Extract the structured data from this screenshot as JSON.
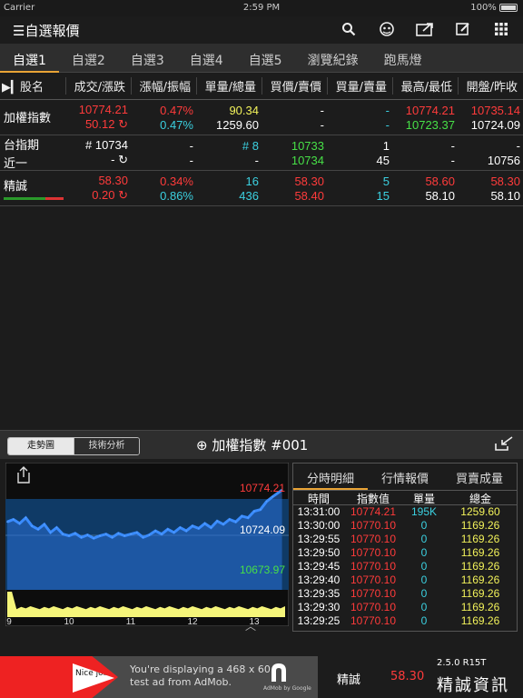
{
  "status_bar": {
    "carrier": "Carrier",
    "time": "2:59 PM",
    "battery": "100%"
  },
  "nav": {
    "title": "自選報價",
    "icons": [
      "search-icon",
      "alert-icon",
      "share-icon",
      "edit-icon",
      "grid-icon"
    ]
  },
  "tabs": [
    "自選1",
    "自選2",
    "自選3",
    "自選4",
    "自選5",
    "瀏覽紀錄",
    "跑馬燈"
  ],
  "active_tab": 0,
  "table_headers": [
    "股名",
    "成交/漲跌",
    "漲幅/振幅",
    "單量/總量",
    "買價/賣價",
    "買量/賣量",
    "最高/最低",
    "開盤/昨收"
  ],
  "rows": [
    {
      "name": "加權指數",
      "name2": "",
      "c": [
        [
          "10774.21",
          "red"
        ],
        [
          "50.12 ↻",
          "red"
        ],
        [
          "0.47%",
          "red"
        ],
        [
          "0.47%",
          "cyan"
        ],
        [
          "90.34",
          "yellow"
        ],
        [
          "1259.60",
          "white"
        ],
        [
          "-",
          "white"
        ],
        [
          "-",
          "white"
        ],
        [
          "-",
          "cyan"
        ],
        [
          "-",
          "cyan"
        ],
        [
          "10774.21",
          "red"
        ],
        [
          "10723.37",
          "green"
        ],
        [
          "10735.14",
          "red"
        ],
        [
          "10724.09",
          "white"
        ]
      ]
    },
    {
      "name": "台指期",
      "name2": "近一",
      "c": [
        [
          "# 10734",
          "white"
        ],
        [
          "- ↻",
          "white"
        ],
        [
          "-",
          "white"
        ],
        [
          "-",
          "white"
        ],
        [
          "# 8",
          "cyan"
        ],
        [
          "-",
          "white"
        ],
        [
          "10733",
          "green"
        ],
        [
          "10734",
          "green"
        ],
        [
          "1",
          "white"
        ],
        [
          "45",
          "white"
        ],
        [
          "-",
          "white"
        ],
        [
          "-",
          "white"
        ],
        [
          "-",
          "white"
        ],
        [
          "10756",
          "white"
        ]
      ]
    },
    {
      "name": "精誠",
      "name2": "",
      "c": [
        [
          "58.30",
          "red"
        ],
        [
          "0.20 ↻",
          "red"
        ],
        [
          "0.34%",
          "red"
        ],
        [
          "0.86%",
          "cyan"
        ],
        [
          "16",
          "cyan"
        ],
        [
          "436",
          "cyan"
        ],
        [
          "58.30",
          "red"
        ],
        [
          "58.40",
          "red"
        ],
        [
          "5",
          "cyan"
        ],
        [
          "15",
          "cyan"
        ],
        [
          "58.60",
          "red"
        ],
        [
          "58.10",
          "white"
        ],
        [
          "58.30",
          "red"
        ],
        [
          "58.10",
          "white"
        ]
      ]
    }
  ],
  "chart_panel": {
    "seg_trend": "走勢圖",
    "seg_tech": "技術分析",
    "title": "加權指數 #001"
  },
  "chart_data": {
    "type": "area",
    "y_high": "10774.21",
    "y_mid": "10724.09",
    "y_low": "10673.97",
    "x_ticks": [
      "9",
      "10",
      "11",
      "12",
      "13"
    ],
    "ylim": [
      10673.97,
      10774.21
    ],
    "x": [
      9.0,
      9.1,
      9.2,
      9.3,
      9.4,
      9.5,
      9.6,
      9.7,
      9.8,
      9.9,
      10.0,
      10.1,
      10.2,
      10.3,
      10.4,
      10.5,
      10.6,
      10.7,
      10.8,
      10.9,
      11.0,
      11.1,
      11.2,
      11.3,
      11.4,
      11.5,
      11.6,
      11.7,
      11.8,
      11.9,
      12.0,
      12.1,
      12.2,
      12.3,
      12.4,
      12.5,
      12.6,
      12.7,
      12.8,
      12.9,
      13.0,
      13.1,
      13.2,
      13.3,
      13.45
    ],
    "values": [
      10735,
      10738,
      10733,
      10740,
      10730,
      10726,
      10732,
      10722,
      10728,
      10720,
      10718,
      10721,
      10716,
      10719,
      10715,
      10718,
      10720,
      10716,
      10721,
      10718,
      10720,
      10722,
      10716,
      10719,
      10724,
      10720,
      10726,
      10722,
      10728,
      10724,
      10730,
      10727,
      10733,
      10728,
      10736,
      10732,
      10738,
      10735,
      10742,
      10740,
      10748,
      10750,
      10760,
      10766,
      10774
    ]
  },
  "detail": {
    "tabs": [
      "分時明細",
      "行情報價",
      "買賣成量"
    ],
    "headers": [
      "時間",
      "指數值",
      "單量",
      "總金"
    ],
    "rows": [
      [
        "13:31:00",
        "10774.21",
        "195K",
        "1259.60"
      ],
      [
        "13:30:00",
        "10770.10",
        "0",
        "1169.26"
      ],
      [
        "13:29:55",
        "10770.10",
        "0",
        "1169.26"
      ],
      [
        "13:29:50",
        "10770.10",
        "0",
        "1169.26"
      ],
      [
        "13:29:45",
        "10770.10",
        "0",
        "1169.26"
      ],
      [
        "13:29:40",
        "10770.10",
        "0",
        "1169.26"
      ],
      [
        "13:29:35",
        "10770.10",
        "0",
        "1169.26"
      ],
      [
        "13:29:30",
        "10770.10",
        "0",
        "1169.26"
      ],
      [
        "13:29:25",
        "10770.10",
        "0",
        "1169.26"
      ]
    ]
  },
  "ad": {
    "badge": "Nice job!",
    "line1": "You're displaying a 468 x 60",
    "line2": "test ad from AdMob.",
    "by": "AdMob by Google"
  },
  "bottom": {
    "name": "精誠",
    "price": "58.30",
    "version": "2.5.0 R15T",
    "brand": "精誠資訊"
  }
}
